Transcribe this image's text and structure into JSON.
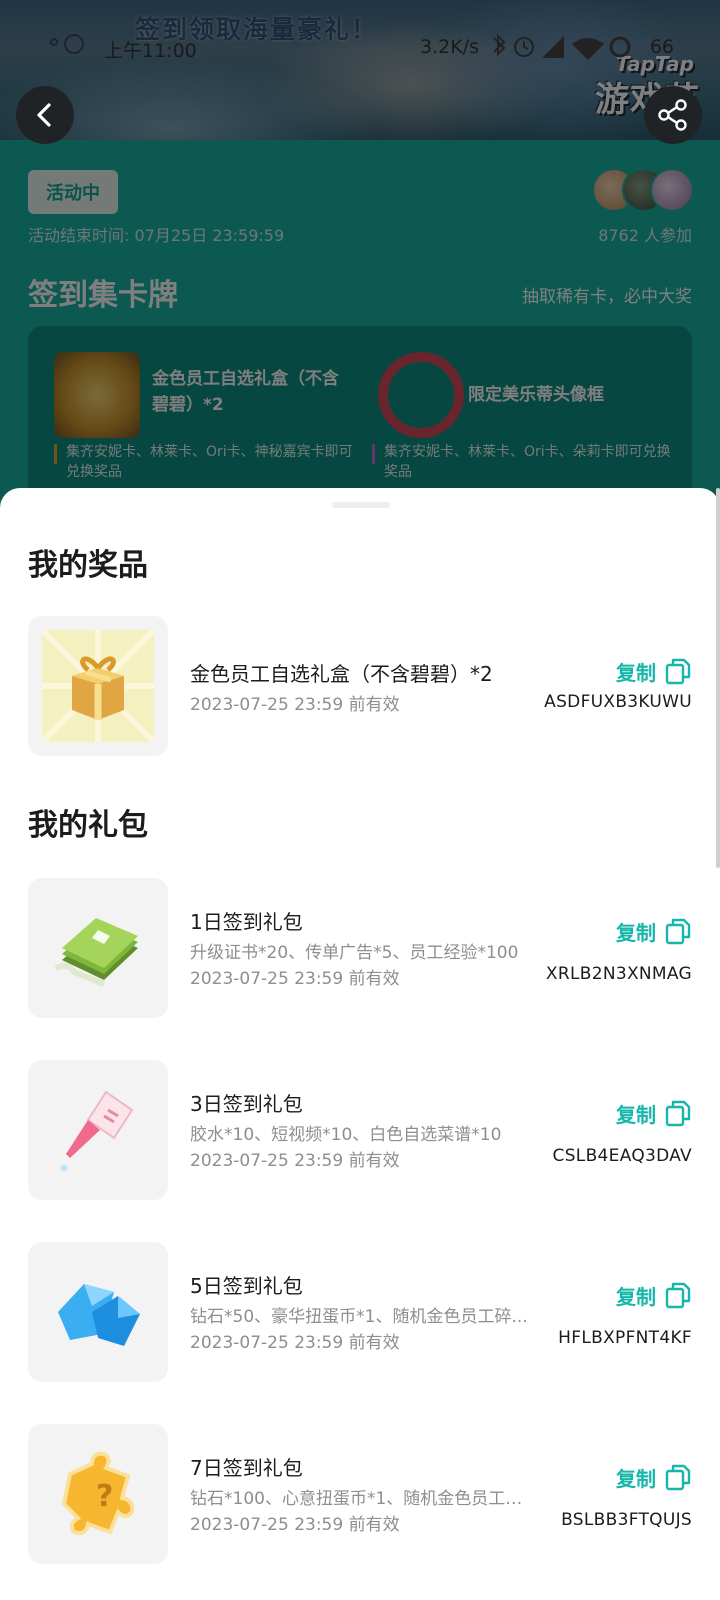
{
  "status_bar": {
    "time": "上午11:00",
    "speed": "3.2K/s",
    "battery": "66"
  },
  "banner": {
    "slogan": "签到领取海量豪礼！",
    "logo_top": "TapTap",
    "logo_main": "游戏节"
  },
  "activity": {
    "status": "活动中",
    "end_time": "活动结束时间: 07月25日 23:59:59",
    "participants": "8762 人参加",
    "section_title": "签到集卡牌",
    "section_tagline": "抽取稀有卡，必中大奖",
    "prizes": [
      {
        "name": "金色员工自选礼盒（不含碧碧）*2",
        "condition": "集齐安妮卡、林莱卡、Ori卡、神秘嘉宾卡即可兑换奖品"
      },
      {
        "name": "限定美乐蒂头像框",
        "condition": "集齐安妮卡、林莱卡、Ori卡、朵莉卡即可兑换奖品"
      }
    ]
  },
  "sheet": {
    "my_prizes_title": "我的奖品",
    "my_gifts_title": "我的礼包",
    "copy_label": "复制",
    "prizes": [
      {
        "title": "金色员工自选礼盒（不含碧碧）*2",
        "valid": "2023-07-25 23:59 前有效",
        "code": "ASDFUXB3KUWU",
        "icon": "gift-box-icon"
      }
    ],
    "gifts": [
      {
        "title": "1日签到礼包",
        "desc": "升级证书*20、传单广告*5、员工经验*100",
        "valid": "2023-07-25 23:59 前有效",
        "code": "XRLB2N3XNMAG",
        "icon": "certificate-stack-icon"
      },
      {
        "title": "3日签到礼包",
        "desc": "胶水*10、短视频*10、白色自选菜谱*10",
        "valid": "2023-07-25 23:59 前有效",
        "code": "CSLB4EAQ3DAV",
        "icon": "glue-bottle-icon"
      },
      {
        "title": "5日签到礼包",
        "desc": "钻石*50、豪华扭蛋币*1、随机金色员工碎...",
        "valid": "2023-07-25 23:59 前有效",
        "code": "HFLBXPFNT4KF",
        "icon": "diamond-icon"
      },
      {
        "title": "7日签到礼包",
        "desc": "钻石*100、心意扭蛋币*1、随机金色员工碎...",
        "valid": "2023-07-25 23:59 前有效",
        "code": "BSLBB3FTQUJS",
        "icon": "puzzle-piece-icon"
      }
    ]
  },
  "colors": {
    "accent": "#16b7aa",
    "activity_bg": "#18b3a3",
    "sheet_bg": "#ffffff"
  }
}
